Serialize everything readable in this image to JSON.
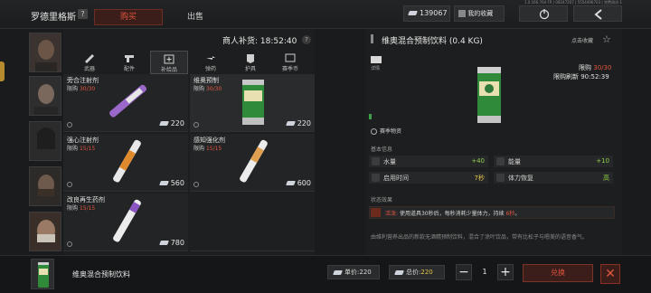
{
  "header": {
    "merchant_name": "罗德里格斯",
    "help": "?",
    "tab_buy": "购买",
    "tab_sell": "出售",
    "currency_amount": "139067",
    "favorites_label": "我的收藏",
    "version_text": "1.0.166.764 FR | 08247207 | 5554496703 | 兜费测试-1"
  },
  "restock": {
    "label": "商人补货: 18:52:40",
    "help": "?"
  },
  "categories": [
    {
      "label": "武器",
      "icon": "gun-icon",
      "selected": false
    },
    {
      "label": "配件",
      "icon": "pistol-icon",
      "selected": false
    },
    {
      "label": "补给品",
      "icon": "medkit-icon",
      "selected": true
    },
    {
      "label": "弹药",
      "icon": "ammo-icon",
      "selected": false
    },
    {
      "label": "护具",
      "icon": "armor-icon",
      "selected": false
    },
    {
      "label": "赛季币",
      "icon": "coin-icon",
      "selected": false
    }
  ],
  "items": [
    {
      "name": "旁合注射剂",
      "limit_label": "限购",
      "limit_value": "30/30",
      "price": "220"
    },
    {
      "name": "维奥预制",
      "limit_label": "限购",
      "limit_value": "30/30",
      "price": "220"
    },
    {
      "name": "强心注射剂",
      "limit_label": "限购",
      "limit_value": "15/15",
      "price": "560"
    },
    {
      "name": "感知强化剂",
      "limit_label": "限购",
      "limit_value": "15/15",
      "price": "600"
    },
    {
      "name": "改良再生药剂",
      "limit_label": "限购",
      "limit_value": "15/15",
      "price": "780"
    }
  ],
  "detail": {
    "title": "维奥混合预制饮料 (0.4 KG)",
    "favorite_label": "点击收藏",
    "icon_label": "详情",
    "limit_label": "限购",
    "limit_value": "30/30",
    "refresh_label": "限购刷新 90:52:39",
    "season_label": "赛季物资",
    "basic_info_label": "基本信息",
    "stats": [
      {
        "label": "水量",
        "value": "+40",
        "tone": "green"
      },
      {
        "label": "能量",
        "value": "+10",
        "tone": "green"
      },
      {
        "label": "启用时间",
        "value": "7秒",
        "tone": "yellow"
      },
      {
        "label": "体力恢复",
        "value": "高",
        "tone": "green"
      }
    ],
    "status_label": "状态效果",
    "status_prefix": "活泼:",
    "status_body": " 使用道具30秒后，每秒消耗少量体力，持续 ",
    "status_highlight": "6秒",
    "status_end": "。",
    "description": "由维利营养出品的新款无酒精预制饮料，混合了涂叶饮品，带有比松子与嗯美的语音香气。"
  },
  "bottom": {
    "item_name": "维奥混合预制饮料",
    "unit_price_label": "单价:",
    "unit_price": "220",
    "total_label": "总价:",
    "total_price": "220",
    "quantity": "1",
    "minus": "−",
    "plus": "+",
    "buy_label": "兑换",
    "close": "✕"
  },
  "colors": {
    "accent_red": "#e0563f",
    "green": "#8ed14a",
    "yellow": "#e1c54a"
  }
}
